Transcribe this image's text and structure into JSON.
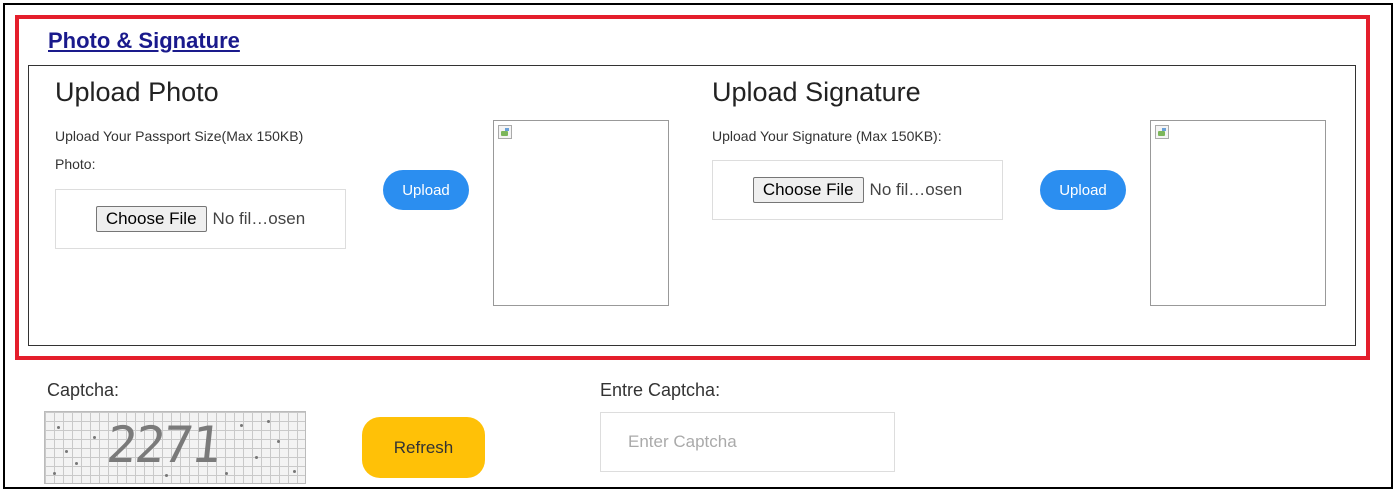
{
  "section": {
    "title": "Photo & Signature"
  },
  "photo": {
    "heading": "Upload Photo",
    "desc_line1": "Upload Your Passport Size(Max 150KB)",
    "desc_line2": "Photo:",
    "choose_label": "Choose File",
    "no_file_text": "No fil…osen",
    "upload_label": "Upload"
  },
  "signature": {
    "heading": "Upload Signature",
    "desc": "Upload Your Signature (Max 150KB):",
    "choose_label": "Choose File",
    "no_file_text": "No fil…osen",
    "upload_label": "Upload"
  },
  "captcha": {
    "label": "Captcha:",
    "code": "2271",
    "refresh_label": "Refresh",
    "enter_label": "Entre Captcha:",
    "placeholder": "Enter Captcha",
    "value": ""
  },
  "colors": {
    "highlight": "#e41e2b",
    "upload_button": "#2b8ef0",
    "refresh_button": "#ffc107",
    "title_link": "#1a1a8c"
  }
}
